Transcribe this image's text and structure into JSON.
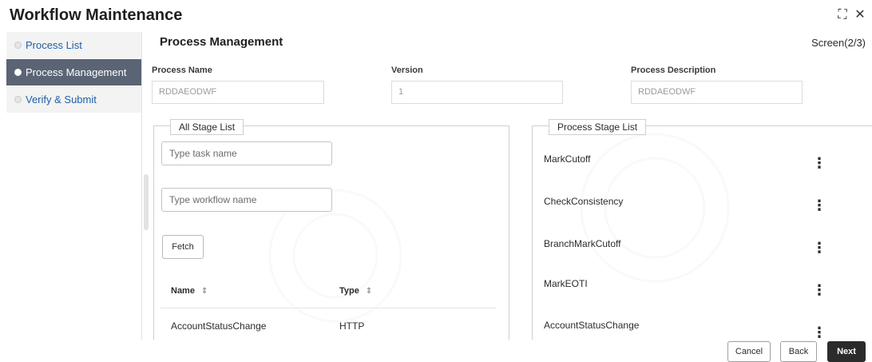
{
  "header": {
    "title": "Workflow Maintenance",
    "expand_icon": "expand-icon",
    "close_icon": "close-icon",
    "expand_glyph": "⛶",
    "close_glyph": "✕"
  },
  "sidebar": {
    "items": [
      {
        "label": "Process List",
        "active": false
      },
      {
        "label": "Process Management",
        "active": true
      },
      {
        "label": "Verify & Submit",
        "active": false
      }
    ]
  },
  "main": {
    "section_title": "Process Management",
    "screen_label": "Screen(2/3)",
    "fields": {
      "process_name": {
        "label": "Process Name",
        "value": "RDDAEODWF"
      },
      "version": {
        "label": "Version",
        "value": "1"
      },
      "process_description": {
        "label": "Process Description",
        "value": "RDDAEODWF"
      }
    },
    "all_stage_list": {
      "legend": "All Stage List",
      "task_placeholder": "Type task name",
      "workflow_placeholder": "Type workflow name",
      "fetch_label": "Fetch",
      "columns": [
        "Name",
        "Type"
      ],
      "sort_glyph": "⇕",
      "rows": [
        {
          "name": "AccountStatusChange",
          "type": "HTTP"
        }
      ]
    },
    "process_stage_list": {
      "legend": "Process Stage List",
      "kebab_glyph": "⋮",
      "items": [
        "MarkCutoff",
        "CheckConsistency",
        "BranchMarkCutoff",
        "MarkEOTI",
        "AccountStatusChange"
      ]
    }
  },
  "footer": {
    "cancel_label": "Cancel",
    "back_label": "Back",
    "next_label": "Next"
  },
  "colors": {
    "active_sidebar": "#5a6475",
    "link": "#1f5fa8",
    "primary_button": "#2b2b2b"
  }
}
